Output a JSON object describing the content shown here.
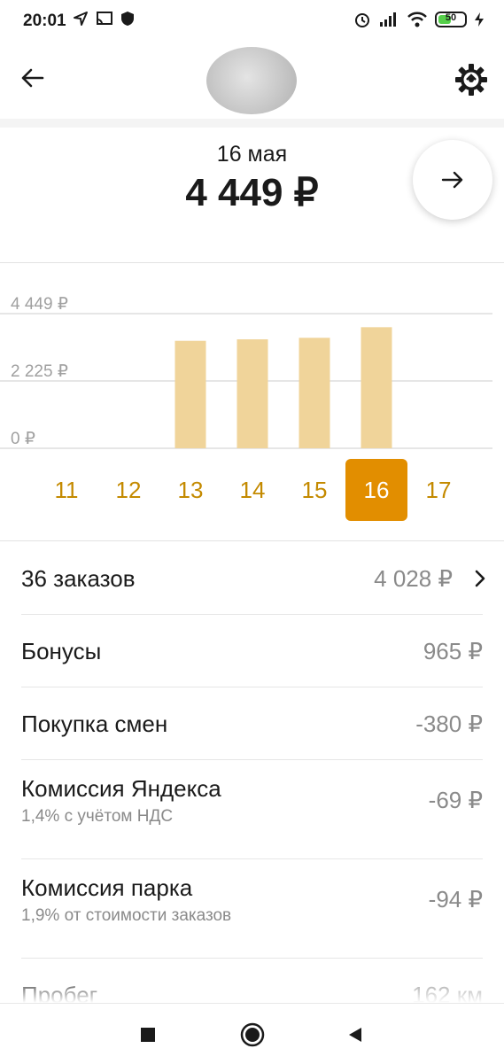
{
  "status_bar": {
    "time": "20:01",
    "battery": "50",
    "battery_level": 0.5,
    "left_icons": [
      "location-arrow-icon",
      "cast-icon",
      "shield-icon"
    ],
    "right_icons": [
      "alarm-icon",
      "signal-icon",
      "wifi-icon",
      "battery-icon",
      "charging-icon"
    ]
  },
  "header": {
    "back_icon": "arrow-left-icon",
    "settings_icon": "gear-icon"
  },
  "summary": {
    "date": "16 мая",
    "amount": "4 449 ₽",
    "next_icon": "arrow-right-icon"
  },
  "chart_data": {
    "type": "bar",
    "y_ticks": [
      "4 449 ₽",
      "2 225 ₽",
      "0 ₽"
    ],
    "ylim": [
      0,
      4449
    ],
    "categories": [
      "11",
      "12",
      "13",
      "14",
      "15",
      "16",
      "17"
    ],
    "values": [
      0,
      0,
      3550,
      3600,
      3650,
      4000,
      0
    ],
    "selected": "16",
    "bar_color": "#f0d49a",
    "selected_color": "#e28e00",
    "grid": true
  },
  "list": [
    {
      "title": "36 заказов",
      "subtitle": "",
      "value": "4 028 ₽",
      "chevron": true
    },
    {
      "title": "Бонусы",
      "subtitle": "",
      "value": "965 ₽",
      "chevron": false
    },
    {
      "title": "Покупка смен",
      "subtitle": "",
      "value": "-380 ₽",
      "chevron": false
    },
    {
      "title": "Комиссия Яндекса",
      "subtitle": "1,4% с учётом НДС",
      "value": "-69 ₽",
      "chevron": false
    },
    {
      "title": "Комиссия парка",
      "subtitle": "1,9% от стоимости заказов",
      "value": "-94 ₽",
      "chevron": false
    },
    {
      "title": "Пробег",
      "subtitle": "",
      "value": "162 км",
      "chevron": false
    }
  ],
  "nav_bar": {
    "icons": [
      "recent-apps-icon",
      "home-icon",
      "back-icon"
    ]
  }
}
